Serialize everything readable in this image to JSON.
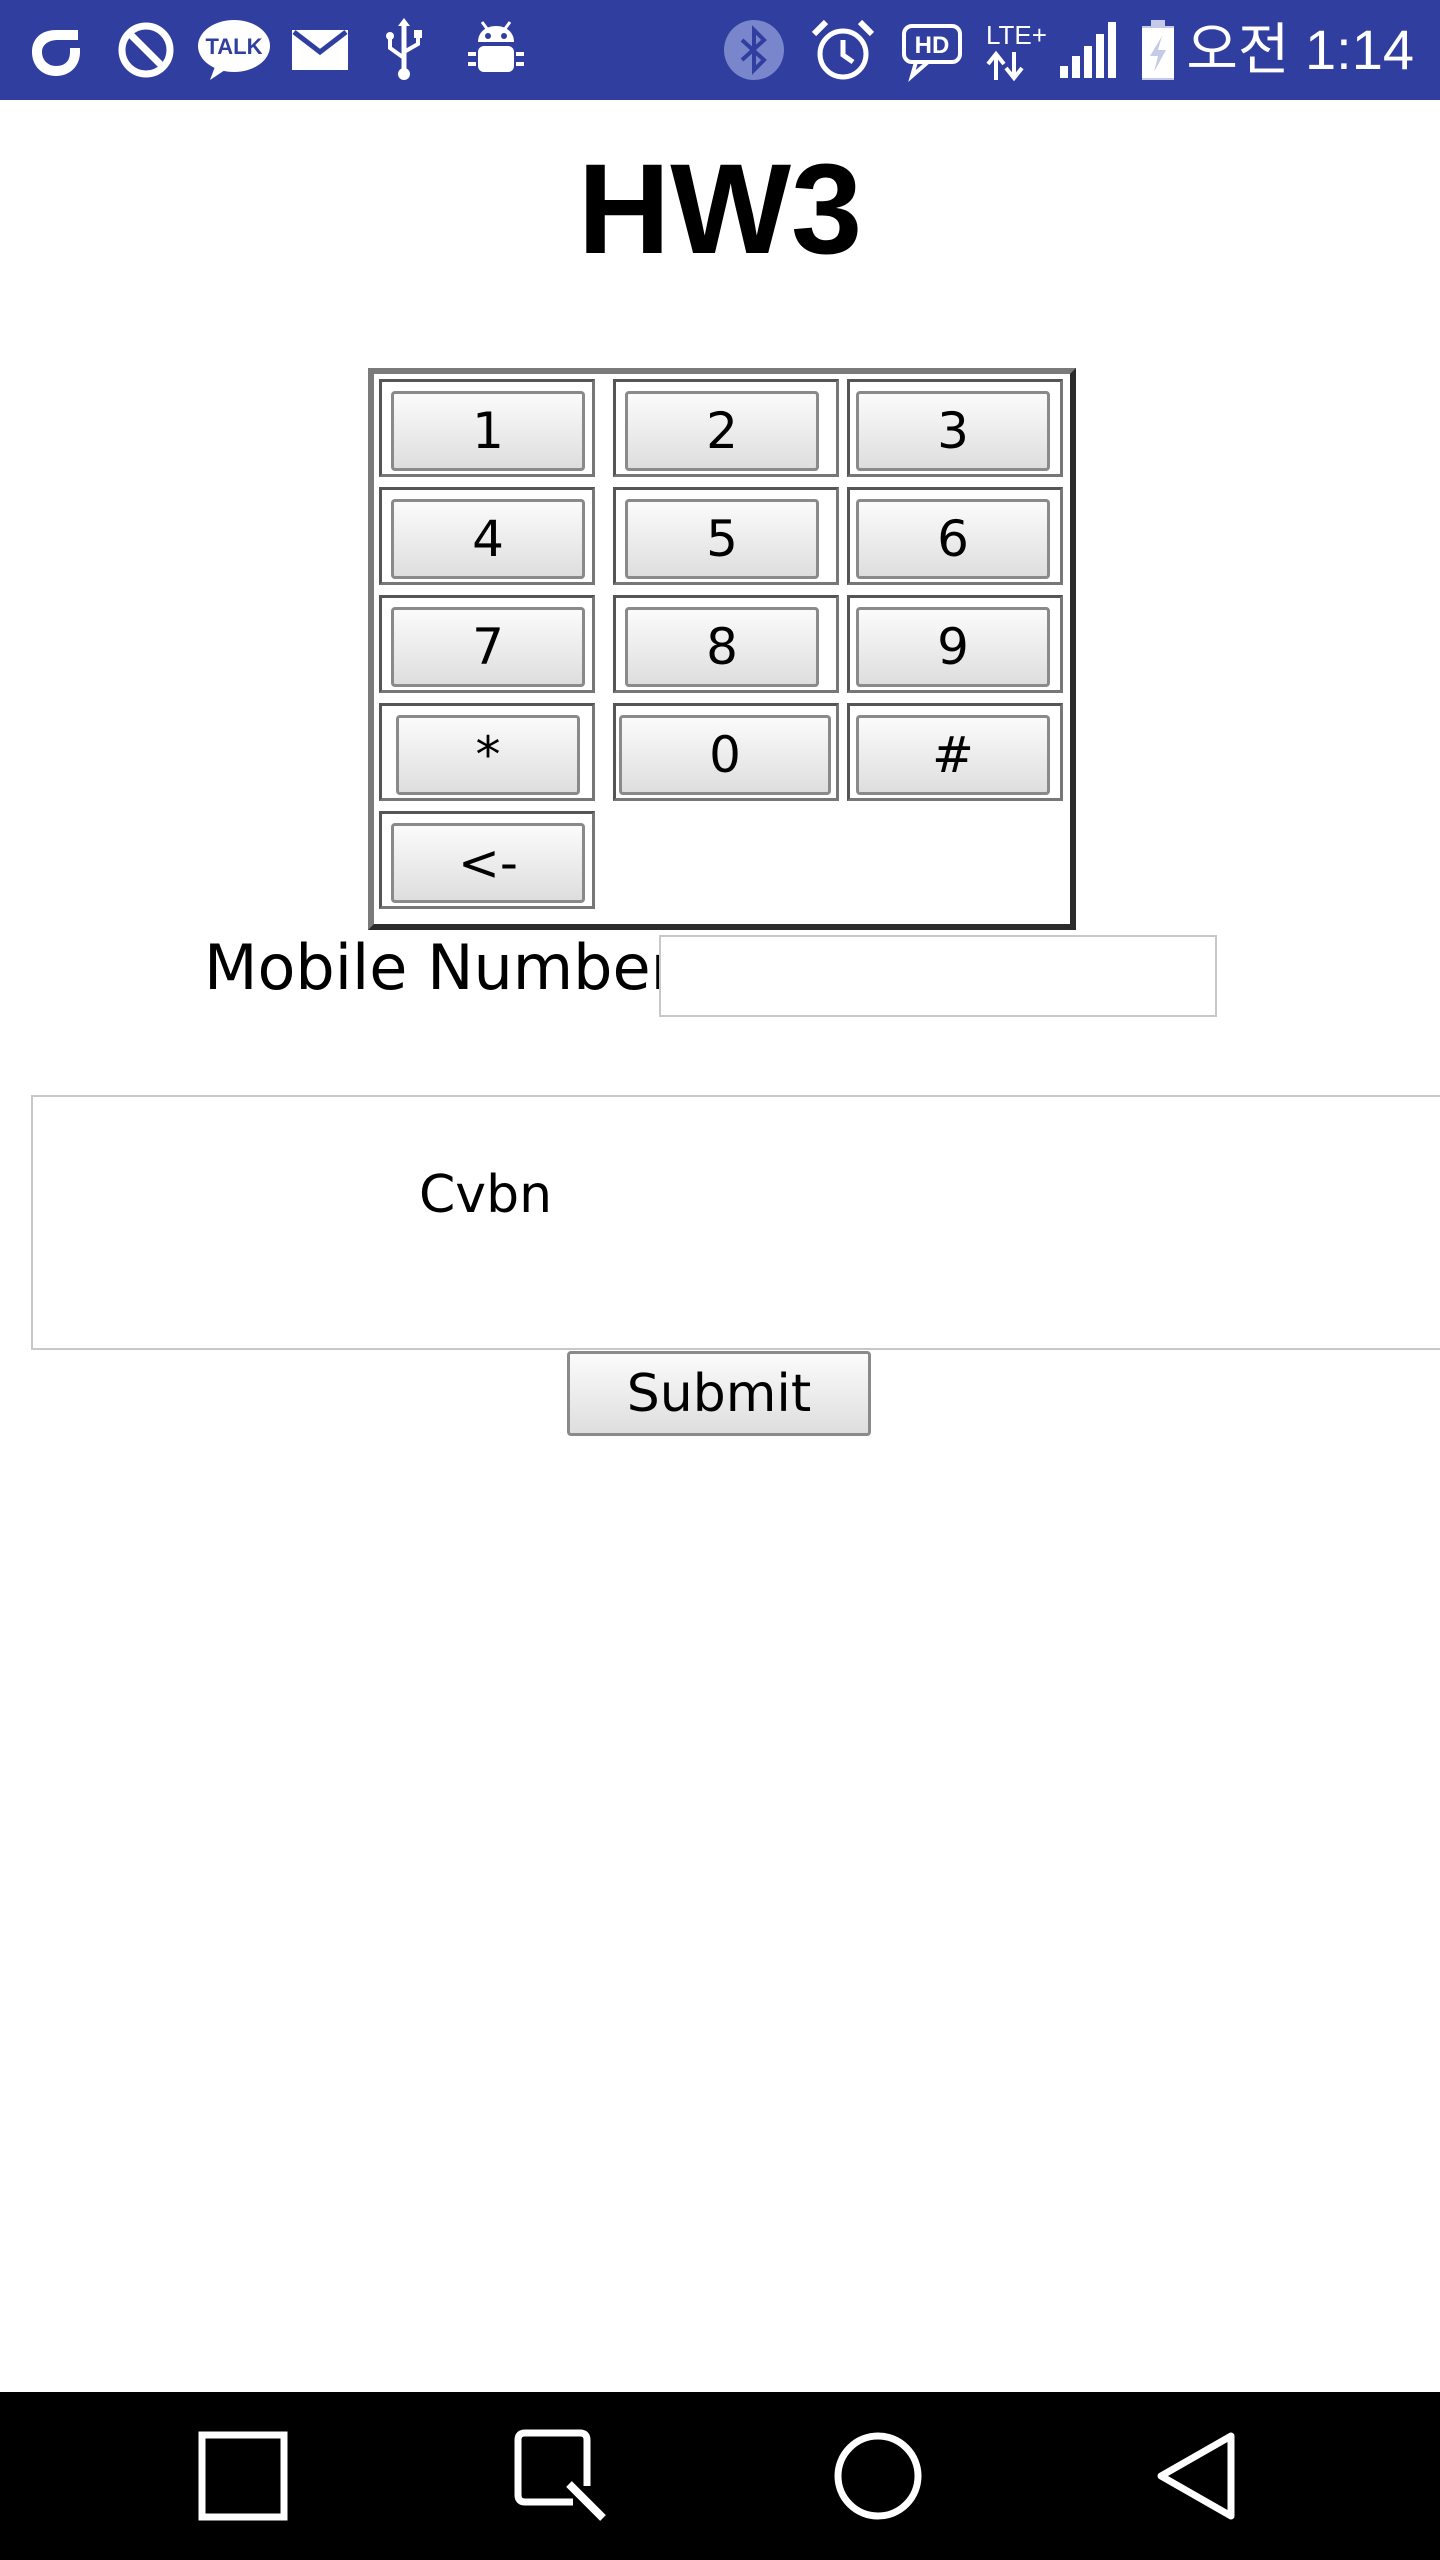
{
  "status_bar": {
    "time": "오전 1:14",
    "icons": [
      "olleh-icon",
      "block-icon",
      "kakaotalk-icon",
      "mail-icon",
      "usb-icon",
      "android-debug-icon",
      "bluetooth-icon",
      "alarm-icon",
      "hd-voice-icon",
      "lte-icon",
      "signal-icon",
      "battery-charging-icon"
    ],
    "icon_labels": {
      "talk": "TALK",
      "hd": "HD",
      "lte": "LTE+"
    },
    "colors": {
      "background": "#303f9f",
      "foreground": "#ffffff"
    }
  },
  "page": {
    "title": "HW3"
  },
  "keypad": {
    "keys": [
      "1",
      "2",
      "3",
      "4",
      "5",
      "6",
      "7",
      "8",
      "9",
      "*",
      "0",
      "#",
      "<-"
    ]
  },
  "form": {
    "mobile_label": "Mobile Number",
    "mobile_value": "",
    "message_value": "Cvbn",
    "submit_label": "Submit"
  },
  "nav_bar": {
    "icons": [
      "recent-apps-icon",
      "capture-icon",
      "home-icon",
      "back-icon"
    ]
  }
}
